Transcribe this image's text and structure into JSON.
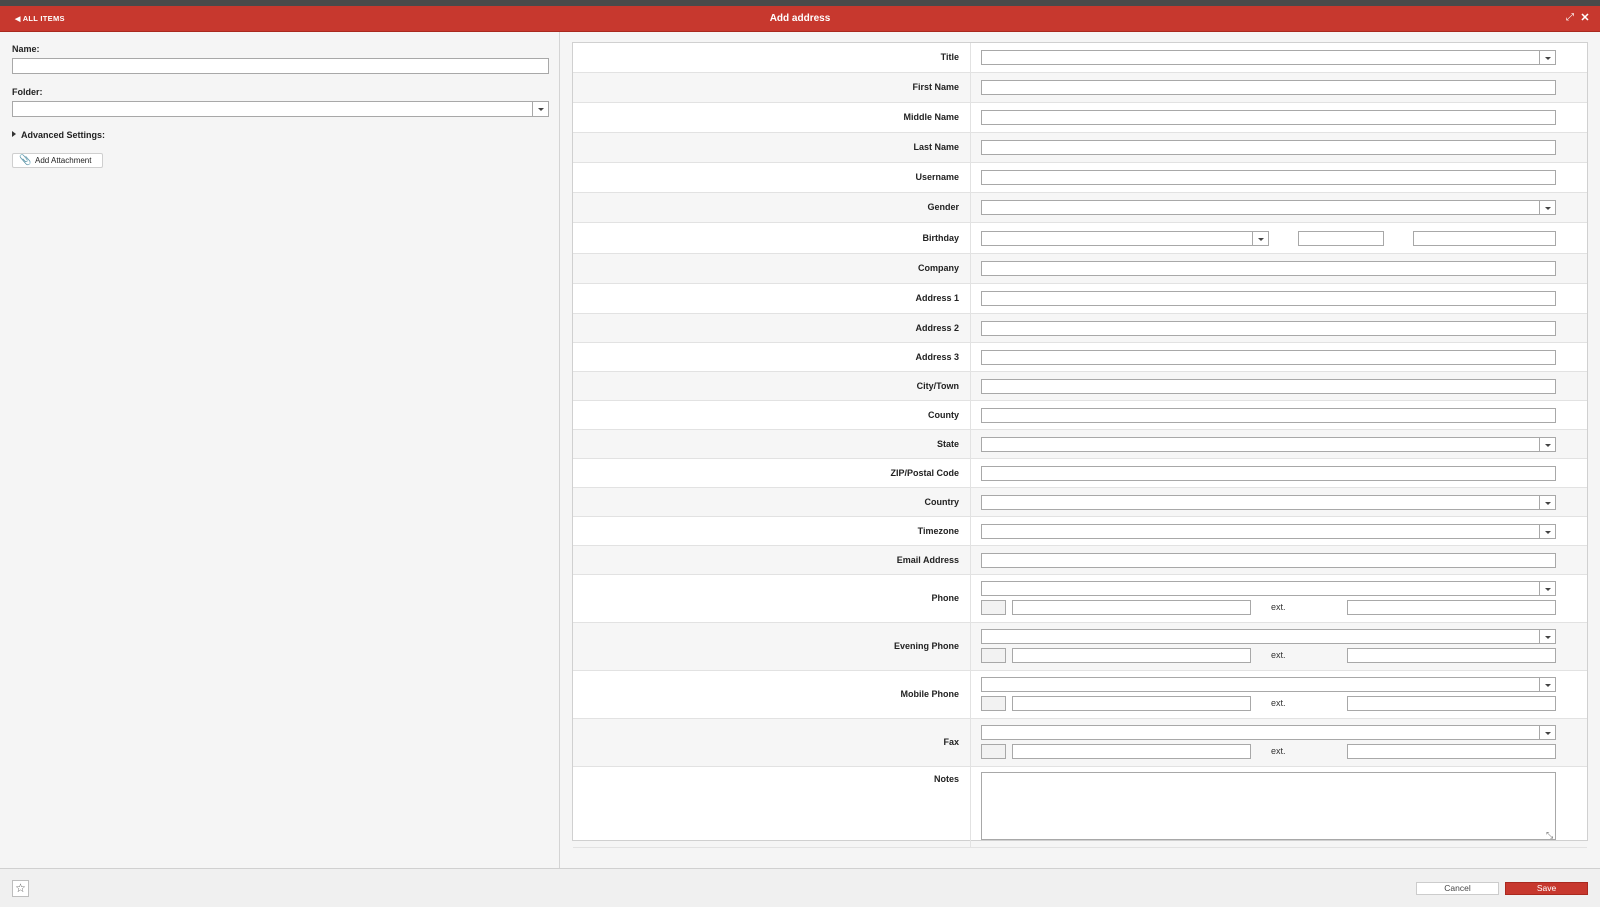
{
  "header": {
    "back_label": "ALL ITEMS",
    "title": "Add address"
  },
  "left": {
    "name_label": "Name:",
    "name_value": "",
    "folder_label": "Folder:",
    "folder_value": "",
    "advanced_label": "Advanced Settings:",
    "attach_label": "Add Attachment"
  },
  "form": {
    "rows": [
      {
        "label": "Title",
        "type": "select"
      },
      {
        "label": "First Name",
        "type": "text"
      },
      {
        "label": "Middle Name",
        "type": "text"
      },
      {
        "label": "Last Name",
        "type": "text"
      },
      {
        "label": "Username",
        "type": "text"
      },
      {
        "label": "Gender",
        "type": "select"
      },
      {
        "label": "Birthday",
        "type": "date"
      },
      {
        "label": "Company",
        "type": "text"
      },
      {
        "label": "Address 1",
        "type": "text"
      },
      {
        "label": "Address 2",
        "type": "text"
      },
      {
        "label": "Address 3",
        "type": "text"
      },
      {
        "label": "City/Town",
        "type": "text"
      },
      {
        "label": "County",
        "type": "text"
      },
      {
        "label": "State",
        "type": "select"
      },
      {
        "label": "ZIP/Postal Code",
        "type": "text"
      },
      {
        "label": "Country",
        "type": "select"
      },
      {
        "label": "Timezone",
        "type": "select"
      },
      {
        "label": "Email Address",
        "type": "text"
      },
      {
        "label": "Phone",
        "type": "phone"
      },
      {
        "label": "Evening Phone",
        "type": "phone"
      },
      {
        "label": "Mobile Phone",
        "type": "phone"
      },
      {
        "label": "Fax",
        "type": "phone"
      },
      {
        "label": "Notes",
        "type": "textarea"
      }
    ],
    "ext_label": "ext."
  },
  "footer": {
    "cancel_label": "Cancel",
    "save_label": "Save"
  },
  "colors": {
    "accent": "#c7382e",
    "panel_bg": "#f5f5f5"
  },
  "icons": {
    "back": "chevron-left-icon",
    "expand": "expand-icon",
    "close": "close-icon",
    "attach": "paperclip-icon",
    "favorite": "star-icon"
  }
}
